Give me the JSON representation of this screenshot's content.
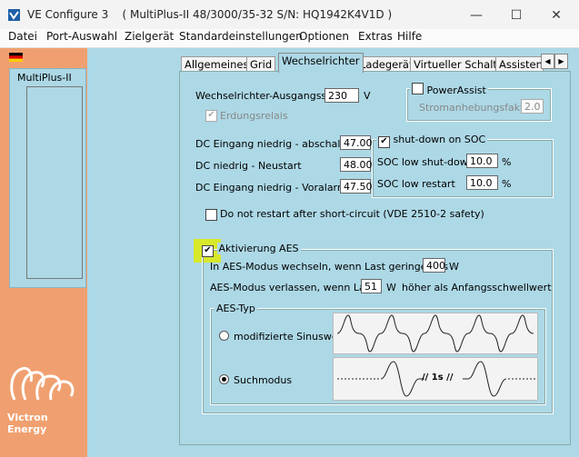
{
  "window": {
    "app_name": "VE Configure 3",
    "device_info": "( MultiPlus-II 48/3000/35-32 S/N: HQ1942K4V1D )"
  },
  "menu": [
    "Datei",
    "Port-Auswahl",
    "Zielgerät",
    "Standardeinstellungen",
    "Optionen",
    "Extras",
    "Hilfe"
  ],
  "left_panel": {
    "device_name": "MultiPlus-II",
    "logo_text": "Victron Energy"
  },
  "tabs": [
    "Allgemeines",
    "Grid",
    "Wechselrichter",
    "Ladegerät",
    "Virtueller Schalter",
    "Assistent"
  ],
  "active_tab": "Wechselrichter",
  "inverter": {
    "output_voltage_label": "Wechselrichter-Ausgangssp.",
    "output_voltage_value": "230",
    "output_voltage_unit": "V",
    "ground_relay_label": "Erdungsrelais",
    "ground_relay_checked": true,
    "dc_low_shutdown_label": "DC Eingang niedrig - abschalten",
    "dc_low_shutdown_value": "47.00",
    "dc_low_restart_label": "DC niedrig - Neustart",
    "dc_low_restart_value": "48.00",
    "dc_low_prealarm_label": "DC Eingang niedrig - Voralarm",
    "dc_low_prealarm_value": "47.50"
  },
  "powerassist": {
    "label": "PowerAssist",
    "checked": false,
    "boost_factor_label": "Stromanhebungsfaktor",
    "boost_factor_value": "2.0"
  },
  "soc": {
    "label": "shut-down on SOC",
    "checked": true,
    "low_shutdown_label": "SOC low shut-down",
    "low_shutdown_value": "10.0",
    "low_restart_label": "SOC low restart",
    "low_restart_value": "10.0",
    "unit": "%"
  },
  "short_circuit": {
    "label": "Do not restart after short-circuit (VDE 2510-2  safety)",
    "checked": false
  },
  "aes": {
    "label": "Aktivierung AES",
    "checked": true,
    "enter_label": "In AES-Modus wechseln, wenn Last geringer als",
    "enter_value": "400",
    "enter_unit": "W",
    "leave_label": "AES-Modus verlassen, wenn Last",
    "leave_value": "51",
    "leave_unit": "W",
    "leave_suffix": "höher als Anfangsschwellwert",
    "type_label": "AES-Typ",
    "options": [
      "modifizierte Sinuswelle",
      "Suchmodus"
    ],
    "selected": "Suchmodus",
    "search_interval_text": "// 1s //"
  }
}
